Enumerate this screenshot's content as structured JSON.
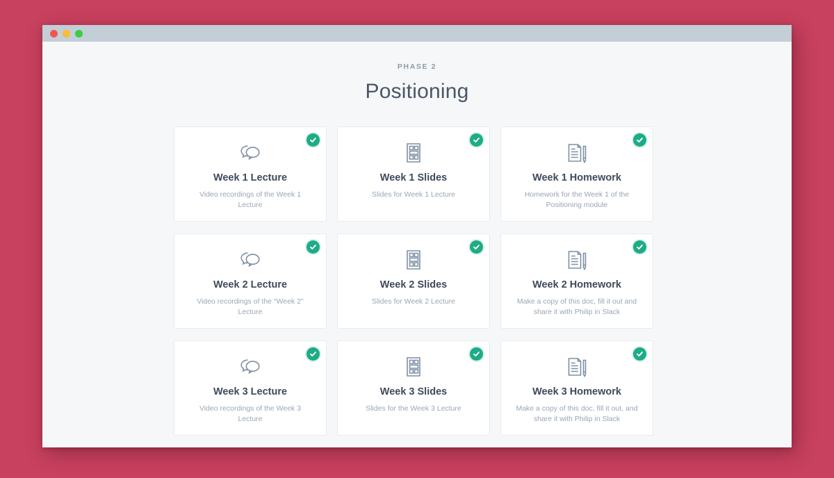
{
  "window": {
    "traffic_lights": [
      {
        "name": "close-button",
        "color": "#f4564f"
      },
      {
        "name": "minimize-button",
        "color": "#f7bd35"
      },
      {
        "name": "maximize-button",
        "color": "#3ccc46"
      }
    ]
  },
  "header": {
    "phase_label": "PHASE 2",
    "title": "Positioning"
  },
  "theme": {
    "page_background": "#f6f7f9",
    "desktop_background": "#c8415e",
    "titlebar": "#c3ced7",
    "badge_green": "#1eab86",
    "icon_stroke": "#7f8fa4",
    "title_text": "#3e4a5a",
    "desc_text": "#9aa6b4"
  },
  "cards": [
    {
      "title": "Week 1 Lecture",
      "description": "Video recordings of the Week 1 Lecture",
      "icon": "speech-bubbles-icon",
      "completed": true
    },
    {
      "title": "Week 1 Slides",
      "description": "Slides for Week 1 Lecture",
      "icon": "slides-layout-icon",
      "completed": true
    },
    {
      "title": "Week 1 Homework",
      "description": "Homework for the Week 1 of the Positioning module",
      "icon": "document-pencil-icon",
      "completed": true
    },
    {
      "title": "Week 2 Lecture",
      "description": "Video recordings of the \"Week 2\" Lecture",
      "icon": "speech-bubbles-icon",
      "completed": true
    },
    {
      "title": "Week 2 Slides",
      "description": "Slides for Week 2 Lecture",
      "icon": "slides-layout-icon",
      "completed": true
    },
    {
      "title": "Week 2 Homework",
      "description": "Make a copy of this doc, fill it out and share it with Philip in Slack",
      "icon": "document-pencil-icon",
      "completed": true
    },
    {
      "title": "Week 3 Lecture",
      "description": "Video recordings of the Week 3 Lecture",
      "icon": "speech-bubbles-icon",
      "completed": true
    },
    {
      "title": "Week 3 Slides",
      "description": "Slides for the Week 3 Lecture",
      "icon": "slides-layout-icon",
      "completed": true
    },
    {
      "title": "Week 3 Homework",
      "description": "Make a copy of this doc, fill it out, and share it with Philip in Slack",
      "icon": "document-pencil-icon",
      "completed": true
    }
  ]
}
